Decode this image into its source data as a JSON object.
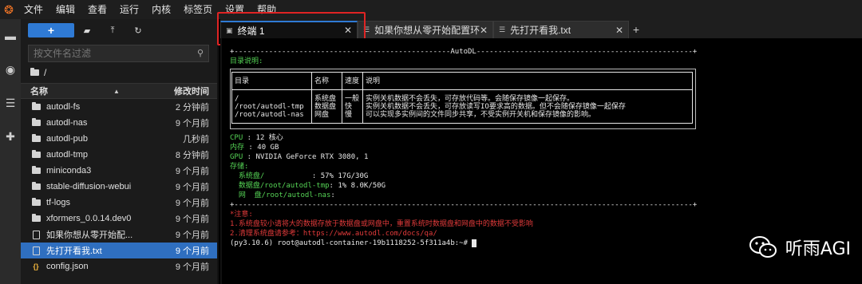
{
  "menu": [
    "文件",
    "编辑",
    "查看",
    "运行",
    "内核",
    "标签页",
    "设置",
    "帮助"
  ],
  "toolbar": {
    "new_label": "+"
  },
  "filter": {
    "placeholder": "按文件名过滤"
  },
  "breadcrumb": "/",
  "headers": {
    "name": "名称",
    "modified": "修改时间"
  },
  "files": [
    {
      "name": "autodl-fs",
      "time": "2 分钟前",
      "type": "folder"
    },
    {
      "name": "autodl-nas",
      "time": "9 个月前",
      "type": "folder"
    },
    {
      "name": "autodl-pub",
      "time": "几秒前",
      "type": "folder"
    },
    {
      "name": "autodl-tmp",
      "time": "8 分钟前",
      "type": "folder"
    },
    {
      "name": "miniconda3",
      "time": "9 个月前",
      "type": "folder"
    },
    {
      "name": "stable-diffusion-webui",
      "time": "9 个月前",
      "type": "folder"
    },
    {
      "name": "tf-logs",
      "time": "9 个月前",
      "type": "folder"
    },
    {
      "name": "xformers_0.0.14.dev0",
      "time": "9 个月前",
      "type": "folder"
    },
    {
      "name": "如果你想从零开始配...",
      "time": "9 个月前",
      "type": "file"
    },
    {
      "name": "先打开看我.txt",
      "time": "9 个月前",
      "type": "file",
      "selected": true
    },
    {
      "name": "config.json",
      "time": "9 个月前",
      "type": "json"
    }
  ],
  "tabs": [
    {
      "label": "终端 1",
      "active": true
    },
    {
      "label": "如果你想从零开始配置环境.t"
    },
    {
      "label": "先打开看我.txt"
    }
  ],
  "terminal": {
    "banner": "+--------------------------------------------------AutoDL--------------------------------------------------+",
    "dir_title": "目录说明:",
    "table_header": [
      "目录",
      "名称",
      "速度",
      "说明"
    ],
    "table_paths": [
      "/",
      "/root/autodl-tmp",
      "/root/autodl-nas"
    ],
    "table_names": [
      "系统盘",
      "数据盘",
      "网盘"
    ],
    "table_speeds": [
      "一般",
      "快",
      "慢"
    ],
    "table_desc": [
      "实例关机数据不会丢失，可存放代码等。会随保存镜像一起保存。",
      "实例关机数据不会丢失，可存放读写IO要求高的数据。但不会随保存镜像一起保存",
      "可以实现多实例间的文件同步共享，不受实例开关机和保存镜像的影响。"
    ],
    "cpu_key": "CPU",
    "cpu_val": " : 12 核心",
    "mem_key": "内存",
    "mem_val": " : 40 GB",
    "gpu_key": "GPU",
    "gpu_val": " : NVIDIA GeForce RTX 3080, 1",
    "storage_key": "存储:",
    "sys_key": "  系统盘/           ",
    "sys_val": ": 57% 17G/30G",
    "data_key": "  数据盘/root/autodl-tmp",
    "data_val": ": 1% 8.0K/50G",
    "net_key": "  网  盘/root/autodl-nas",
    "net_val": ":",
    "separator": "+----------------------------------------------------------------------------------------------------------+",
    "note_title": "*注意:",
    "note_1": "1.系统盘较小请将大的数据存放于数据盘或网盘中，重置系统时数据盘和网盘中的数据不受影响",
    "note_2": "2.清理系统盘请参考：https://www.autodl.com/docs/qa/",
    "prompt": "(py3.10.6) root@autodl-container-19b1118252-5f311a4b:~# "
  },
  "watermark": {
    "text": "听雨AGI"
  }
}
